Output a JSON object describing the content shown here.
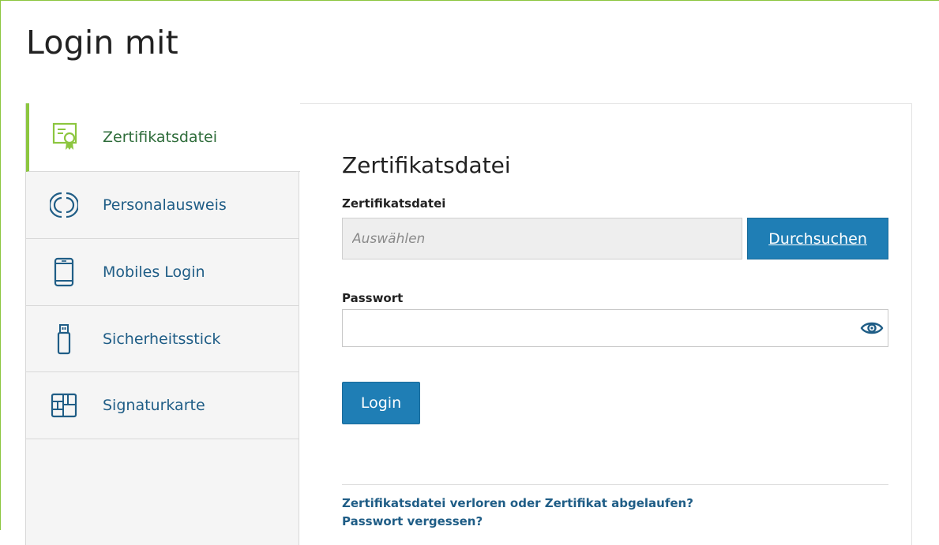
{
  "page": {
    "title": "Login mit"
  },
  "sidebar": {
    "items": [
      {
        "label": "Zertifikatsdatei",
        "icon": "certificate-file-icon",
        "active": true
      },
      {
        "label": "Personalausweis",
        "icon": "id-card-nfc-icon",
        "active": false
      },
      {
        "label": "Mobiles Login",
        "icon": "smartphone-icon",
        "active": false
      },
      {
        "label": "Sicherheitsstick",
        "icon": "usb-stick-icon",
        "active": false
      },
      {
        "label": "Signaturkarte",
        "icon": "chip-card-icon",
        "active": false
      }
    ]
  },
  "form": {
    "section_title": "Zertifikatsdatei",
    "file_label": "Zertifikatsdatei",
    "file_placeholder": "Auswählen",
    "browse_label": "Durchsuchen",
    "password_label": "Passwort",
    "password_value": "",
    "show_password_icon": "eye-icon",
    "login_label": "Login"
  },
  "help": {
    "lost_certificate": "Zertifikatsdatei verloren oder Zertifikat abgelaufen?",
    "forgot_password": "Passwort vergessen?"
  },
  "colors": {
    "accent_green": "#8cc63f",
    "primary_blue": "#1f7eb5",
    "link_blue": "#1f5d86"
  }
}
